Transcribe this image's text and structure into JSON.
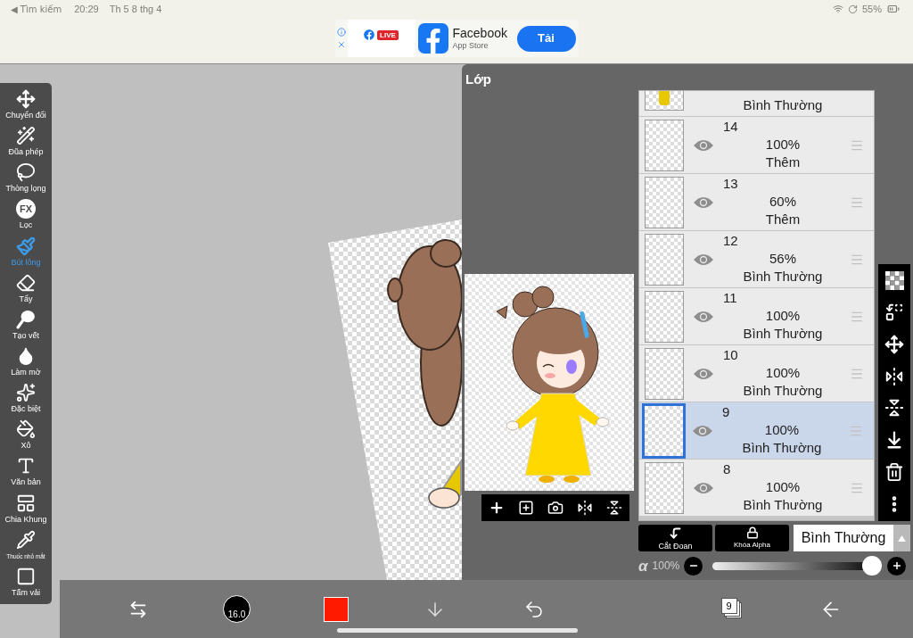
{
  "status_bar": {
    "back": "◀ Tìm kiếm",
    "time": "20:29",
    "date": "Th 5 8 thg 4",
    "battery": "55%"
  },
  "ad": {
    "badge": "LIVE",
    "app_name": "Facebook",
    "store": "App Store",
    "button": "Tải"
  },
  "tools": [
    {
      "kind": "move",
      "label": "Chuyển đổi",
      "selected": false
    },
    {
      "kind": "wand",
      "label": "Đũa phép",
      "selected": false
    },
    {
      "kind": "lasso",
      "label": "Thòng lọng",
      "selected": false
    },
    {
      "kind": "filter",
      "label": "Lọc",
      "icon_text": "FX",
      "selected": false
    },
    {
      "kind": "brush",
      "label": "Bút lông",
      "selected": true
    },
    {
      "kind": "eraser",
      "label": "Tẩy",
      "selected": false
    },
    {
      "kind": "smudge",
      "label": "Tạo vết",
      "selected": false
    },
    {
      "kind": "blur",
      "label": "Làm mờ",
      "selected": false
    },
    {
      "kind": "special",
      "label": "Đặc biệt",
      "selected": false
    },
    {
      "kind": "bucket",
      "label": "Xô",
      "selected": false
    },
    {
      "kind": "text",
      "label": "Văn bản",
      "selected": false
    },
    {
      "kind": "frame",
      "label": "Chia Khung",
      "selected": false
    },
    {
      "kind": "eyedropper",
      "label": "Thuốc nhỏ mắt",
      "selected": false
    },
    {
      "kind": "canvas",
      "label": "Tấm vải",
      "selected": false
    }
  ],
  "layer_panel": {
    "title": "Lớp",
    "preview_tools": [
      {
        "kind": "add"
      },
      {
        "kind": "add_layer"
      },
      {
        "kind": "camera"
      },
      {
        "kind": "flip_horizontal"
      },
      {
        "kind": "flip_vertical"
      }
    ],
    "layers": [
      {
        "blend": "Bình Thường",
        "selected": false
      },
      {
        "number": "14",
        "opacity": "100%",
        "blend": "Thêm",
        "visible": true,
        "selected": false
      },
      {
        "number": "13",
        "opacity": "60%",
        "blend": "Thêm",
        "visible": true,
        "selected": false
      },
      {
        "number": "12",
        "opacity": "56%",
        "blend": "Bình Thường",
        "visible": true,
        "selected": false
      },
      {
        "number": "11",
        "opacity": "100%",
        "blend": "Bình Thường",
        "visible": true,
        "selected": false
      },
      {
        "number": "10",
        "opacity": "100%",
        "blend": "Bình Thường",
        "visible": true,
        "selected": false
      },
      {
        "number": "9",
        "opacity": "100%",
        "blend": "Bình Thường",
        "visible": true,
        "selected": true
      },
      {
        "number": "8",
        "opacity": "100%",
        "blend": "Bình Thường",
        "visible": true,
        "selected": false
      }
    ],
    "layer_tools": [
      {
        "kind": "transparent"
      },
      {
        "kind": "arrange"
      },
      {
        "kind": "move"
      },
      {
        "kind": "flip_horizontal"
      },
      {
        "kind": "flip_vertical"
      },
      {
        "kind": "merge_down"
      },
      {
        "kind": "delete"
      },
      {
        "kind": "more"
      }
    ],
    "buttons": [
      {
        "kind": "clip",
        "label": "Cắt Đoan"
      },
      {
        "kind": "alpha_lock",
        "label": "Khóa Alpha"
      }
    ],
    "blend_mode": "Bình Thường",
    "opacity": {
      "symbol": "α",
      "reading": "100%",
      "level": 1
    }
  },
  "bottom_toolbar": [
    {
      "kind": "swap"
    },
    {
      "kind": "brush_size",
      "label": "16.0"
    },
    {
      "kind": "color",
      "color": "#ff1a00"
    },
    {
      "kind": "down"
    },
    {
      "kind": "undo"
    },
    {
      "kind": "layers",
      "label": "9"
    },
    {
      "kind": "back"
    }
  ]
}
